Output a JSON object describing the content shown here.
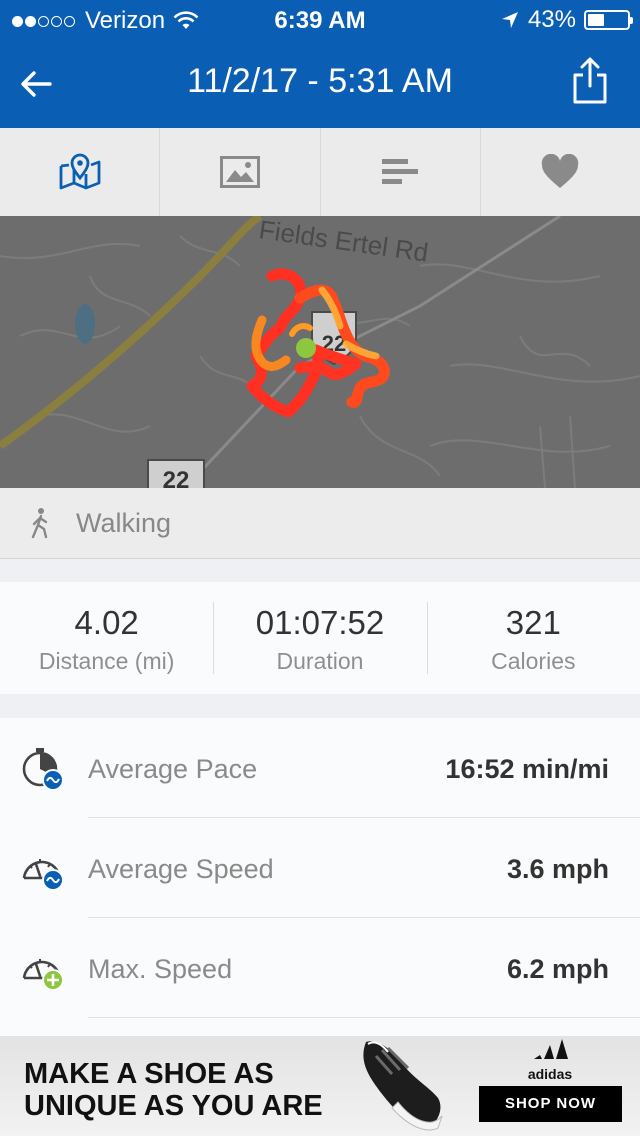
{
  "status_bar": {
    "carrier": "Verizon",
    "time": "6:39 AM",
    "battery": "43%",
    "battery_level": 0.43,
    "signal_bars_filled": 2,
    "signal_bars_total": 5
  },
  "header": {
    "title": "11/2/17 - 5:31 AM",
    "back_icon": "back-arrow-icon",
    "share_icon": "share-icon"
  },
  "tabs": [
    {
      "name": "map",
      "icon": "map-icon",
      "active": true
    },
    {
      "name": "photos",
      "icon": "photo-icon",
      "active": false
    },
    {
      "name": "splits",
      "icon": "bars-icon",
      "active": false
    },
    {
      "name": "likes",
      "icon": "heart-icon",
      "active": false
    }
  ],
  "map": {
    "road_label": "Fields Ertel Rd",
    "route_shield": "22",
    "route_shield_2": "22"
  },
  "activity": {
    "type": "Walking",
    "icon": "walking-icon"
  },
  "stats": [
    {
      "value": "4.02",
      "label": "Distance (mi)"
    },
    {
      "value": "01:07:52",
      "label": "Duration"
    },
    {
      "value": "321",
      "label": "Calories"
    }
  ],
  "metrics": [
    {
      "label": "Average Pace",
      "value": "16:52 min/mi",
      "icon": "pace-icon"
    },
    {
      "label": "Average Speed",
      "value": "3.6 mph",
      "icon": "avg-speed-icon"
    },
    {
      "label": "Max. Speed",
      "value": "6.2 mph",
      "icon": "max-speed-icon"
    }
  ],
  "ad": {
    "headline_line1": "MAKE A SHOE AS",
    "headline_line2": "UNIQUE AS YOU ARE",
    "brand": "adidas",
    "cta": "SHOP NOW"
  },
  "colors": {
    "primary": "#0a5fb4",
    "route": "#ff3322",
    "start_marker": "#8dc63f"
  }
}
